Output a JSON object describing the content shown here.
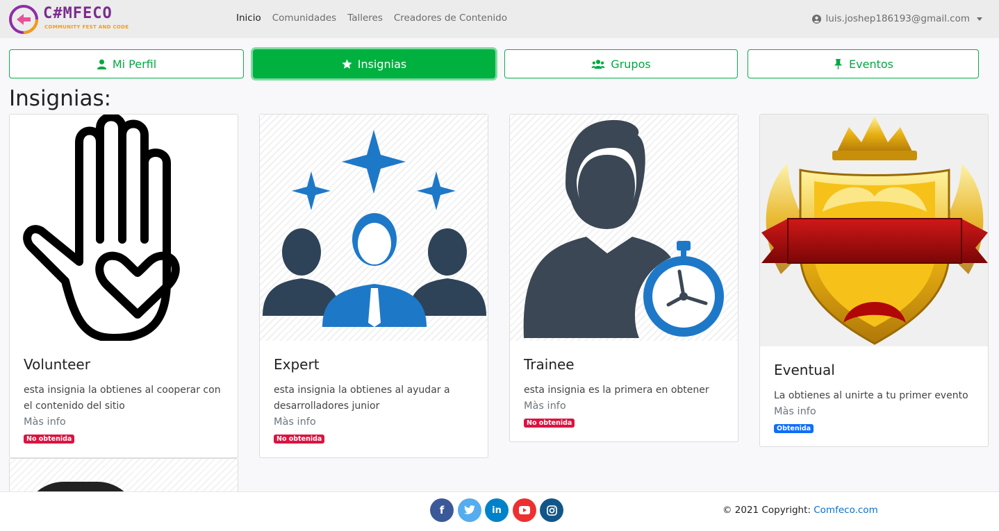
{
  "brand": {
    "name": "C#MFECO",
    "tagline": "COMMUNITY FEST AND CODE"
  },
  "nav": {
    "links": [
      "Inicio",
      "Comunidades",
      "Talleres",
      "Creadores de Contenido"
    ],
    "user_email": "luis.joshep186193@gmail.com"
  },
  "tabs": [
    "Mi Perfil",
    "Insignias",
    "Grupos",
    "Eventos"
  ],
  "page_title": "Insignias:",
  "badges": [
    {
      "title": "Volunteer",
      "description": "esta insignia la obtienes al cooperar con el contenido del sitio",
      "more": "Màs info",
      "status": "No obtenida"
    },
    {
      "title": "Expert",
      "description": "esta insignia la obtienes al ayudar a desarrolladores junior",
      "more": "Màs info",
      "status": "No obtenida"
    },
    {
      "title": "Trainee",
      "description": "esta insignia es la primera en obtener",
      "more": "Màs info",
      "status": "No obtenida"
    },
    {
      "title": "Eventual",
      "description": "La obtienes al unirte a tu primer evento",
      "more": "Màs info",
      "status": "Obtenida"
    }
  ],
  "footer": {
    "social": [
      "facebook",
      "twitter",
      "linkedin",
      "youtube",
      "instagram"
    ],
    "copyright": "© 2021 Copyright:",
    "site_link": "Comfeco.com"
  },
  "colors": {
    "accent_green": "#00b140",
    "badge_red": "#dc1340",
    "badge_blue": "#0d6efd",
    "facebook": "#3b5998",
    "twitter": "#55acee",
    "linkedin": "#0082ca",
    "youtube": "#ed302f",
    "instagram": "#125688"
  }
}
